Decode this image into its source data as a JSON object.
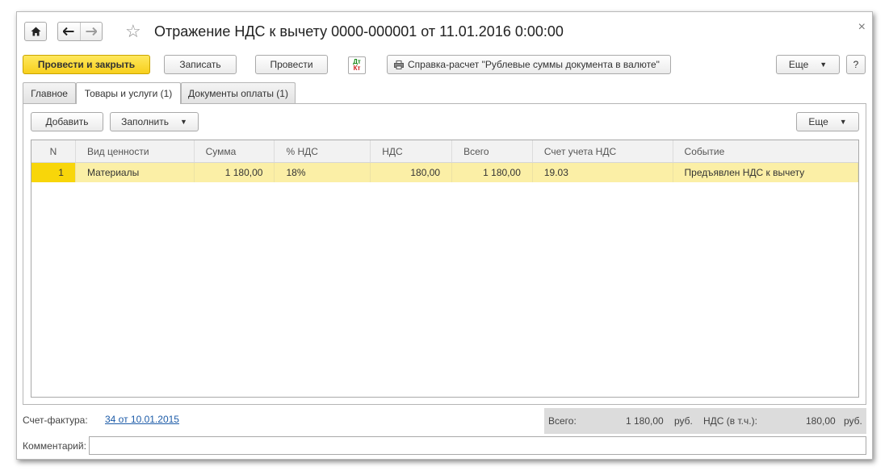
{
  "window": {
    "title": "Отражение НДС к вычету 0000-000001 от 11.01.2016 0:00:00",
    "close_symbol": "×"
  },
  "nav": {
    "home_icon": "home-icon",
    "back_icon": "arrow-left-icon",
    "forward_icon": "arrow-right-icon",
    "favorite_icon": "star-icon",
    "star_glyph": "☆"
  },
  "toolbar": {
    "post_close_label": "Провести и закрыть",
    "save_label": "Записать",
    "post_label": "Провести",
    "dtkt_top": "Дт",
    "dtkt_bottom": "Кт",
    "report_label": "Справка-расчет \"Рублевые суммы документа в валюте\"",
    "more_label": "Еще",
    "help_label": "?"
  },
  "tabs": [
    {
      "label": "Главное"
    },
    {
      "label": "Товары и услуги (1)"
    },
    {
      "label": "Документы оплаты (1)"
    }
  ],
  "table_toolbar": {
    "add_label": "Добавить",
    "fill_label": "Заполнить",
    "more_label": "Еще"
  },
  "table": {
    "columns": [
      "N",
      "Вид ценности",
      "Сумма",
      "% НДС",
      "НДС",
      "Всего",
      "Счет учета НДС",
      "Событие"
    ],
    "rows": [
      [
        "1",
        "Материалы",
        "1 180,00",
        "18%",
        "180,00",
        "1 180,00",
        "19.03",
        "Предъявлен НДС к вычету"
      ]
    ]
  },
  "footer": {
    "invoice_label": "Счет-фактура:",
    "invoice_link": "34 от 10.01.2015",
    "total_label": "Всего:",
    "total_value": "1 180,00",
    "currency1": "руб.",
    "vat_label": "НДС (в т.ч.):",
    "vat_value": "180,00",
    "currency2": "руб.",
    "comment_label": "Комментарий:",
    "comment_value": ""
  },
  "colors": {
    "primary_button": "#f7cf1d",
    "selected_row": "#fbefa6",
    "row_marker": "#f8d60a",
    "link": "#1c5ba8"
  }
}
